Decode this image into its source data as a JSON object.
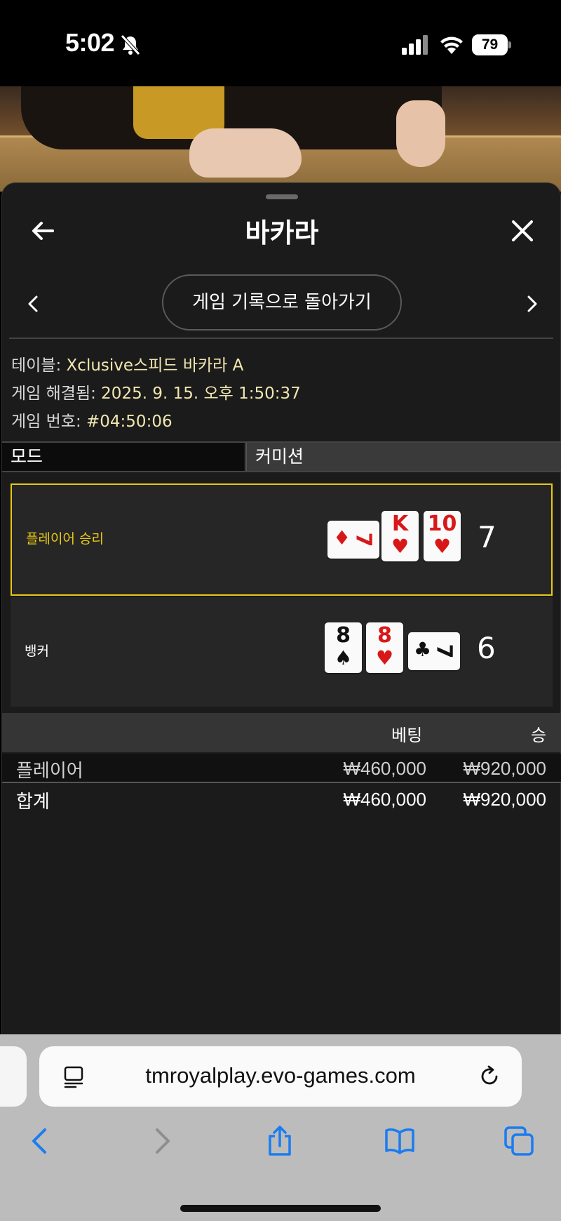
{
  "status": {
    "time": "5:02",
    "battery": "79",
    "icons": [
      "bell-slash-icon",
      "cellular-signal-icon",
      "wifi-icon",
      "battery-icon"
    ]
  },
  "panel": {
    "title": "바카라",
    "back_button_label": "게임 기록으로 돌아가기",
    "icons": [
      "back-arrow-icon",
      "close-icon",
      "chevron-left-icon",
      "chevron-right-icon"
    ]
  },
  "info": {
    "table_label": "테이블: ",
    "table_value": "Xclusive스피드 바카라 A",
    "resolved_label": "게임 해결됨: ",
    "resolved_value": "2025. 9. 15. 오후 1:50:37",
    "number_label": "게임 번호: ",
    "number_value": "#04:50:06"
  },
  "mode": {
    "mode_label": "모드",
    "commission_label": "커미션"
  },
  "results": {
    "player": {
      "label": "플레이어 승리",
      "score": "7",
      "cards": [
        {
          "rank": "7",
          "suit": "♦",
          "color": "red",
          "orientation": "sideways"
        },
        {
          "rank": "K",
          "suit": "♥",
          "color": "red",
          "orientation": "upright"
        },
        {
          "rank": "10",
          "suit": "♥",
          "color": "red",
          "orientation": "upright"
        }
      ]
    },
    "banker": {
      "label": "뱅커",
      "score": "6",
      "cards": [
        {
          "rank": "8",
          "suit": "♠",
          "color": "black",
          "orientation": "upright"
        },
        {
          "rank": "8",
          "suit": "♥",
          "color": "red",
          "orientation": "upright"
        },
        {
          "rank": "7",
          "suit": "♣",
          "color": "black",
          "orientation": "sideways"
        }
      ]
    }
  },
  "bets": {
    "header_bet": "베팅",
    "header_win": "승",
    "rows": [
      {
        "name": "플레이어",
        "bet": "₩460,000",
        "win": "₩920,000"
      }
    ],
    "total": {
      "name": "합계",
      "bet": "₩460,000",
      "win": "₩920,000"
    }
  },
  "browser": {
    "url": "tmroyalplay.evo-games.com",
    "toolbar_icons": [
      "back-icon",
      "forward-icon",
      "share-icon",
      "bookmarks-icon",
      "tabs-icon"
    ]
  },
  "colors": {
    "panel_bg": "#1b1b1b",
    "winner_border": "#e6c817",
    "info_value": "#f2e6b0",
    "card_red": "#d81818",
    "ios_blue": "#1a7cf0"
  }
}
